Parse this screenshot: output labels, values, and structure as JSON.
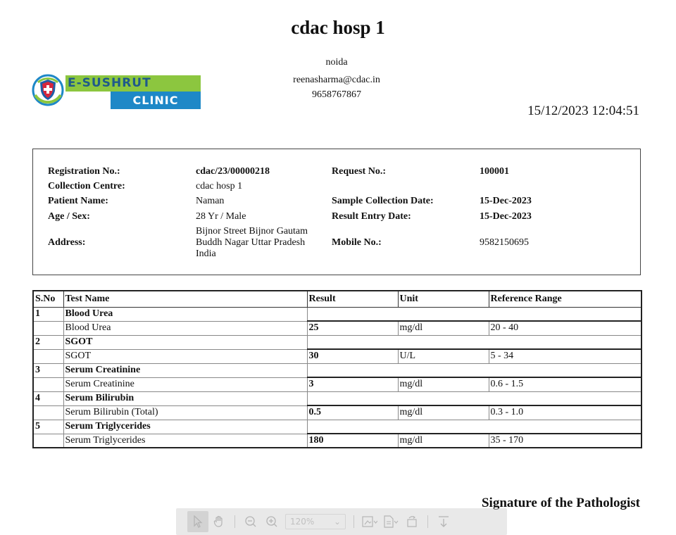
{
  "header": {
    "hospital_name": "cdac hosp 1",
    "city": "noida",
    "email": "reenasharma@cdac.in",
    "phone": "9658767867",
    "print_datetime": "15/12/2023 12:04:51"
  },
  "logo": {
    "line1": "E-SUSHRUT",
    "line2": "CLINIC",
    "colors": {
      "green": "#8cc63f",
      "blue": "#1e88c7",
      "red": "#d7263d"
    }
  },
  "patient": {
    "labels": {
      "registration_no": "Registration No.:",
      "collection_centre": "Collection Centre:",
      "patient_name": "Patient Name:",
      "age_sex": "Age / Sex:",
      "address": "Address:",
      "request_no": "Request No.:",
      "sample_collection_date": "Sample Collection Date:",
      "result_entry_date": "Result Entry Date:",
      "mobile_no": "Mobile No.:"
    },
    "values": {
      "registration_no": "cdac/23/00000218",
      "collection_centre": "cdac hosp 1",
      "patient_name": "Naman",
      "age_sex": "28 Yr / Male",
      "address_line1": "Bijnor Street Bijnor Gautam",
      "address_line2": "Buddh Nagar Uttar Pradesh",
      "address_line3": "India",
      "request_no": "100001",
      "sample_collection_date": "15-Dec-2023",
      "result_entry_date": "15-Dec-2023",
      "mobile_no": "9582150695"
    }
  },
  "results_table": {
    "columns": [
      "S.No",
      "Test Name",
      "Result",
      "Unit",
      "Reference Range"
    ],
    "groups": [
      {
        "sno": "1",
        "name": "Blood Urea",
        "test": "Blood Urea",
        "result": "25",
        "unit": "mg/dl",
        "range": "20 - 40"
      },
      {
        "sno": "2",
        "name": "SGOT",
        "test": "SGOT",
        "result": "30",
        "unit": "U/L",
        "range": "5 - 34"
      },
      {
        "sno": "3",
        "name": "Serum Creatinine",
        "test": "Serum Creatinine",
        "result": "3",
        "unit": "mg/dl",
        "range": "0.6 - 1.5"
      },
      {
        "sno": "4",
        "name": "Serum Bilirubin",
        "test": "Serum Bilirubin (Total)",
        "result": "0.5",
        "unit": "mg/dl",
        "range": "0.3 - 1.0"
      },
      {
        "sno": "5",
        "name": "Serum Triglycerides",
        "test": "Serum Triglycerides",
        "result": "180",
        "unit": "mg/dl",
        "range": "35 - 170"
      }
    ]
  },
  "footer": {
    "signature_label": "Signature of the Pathologist"
  },
  "viewer_toolbar": {
    "zoom_value": "120%",
    "icons": [
      "select-cursor-icon",
      "hand-pan-icon",
      "zoom-out-icon",
      "zoom-in-icon",
      "fit-page-icon",
      "page-view-icon",
      "rotate-icon",
      "download-icon"
    ]
  }
}
